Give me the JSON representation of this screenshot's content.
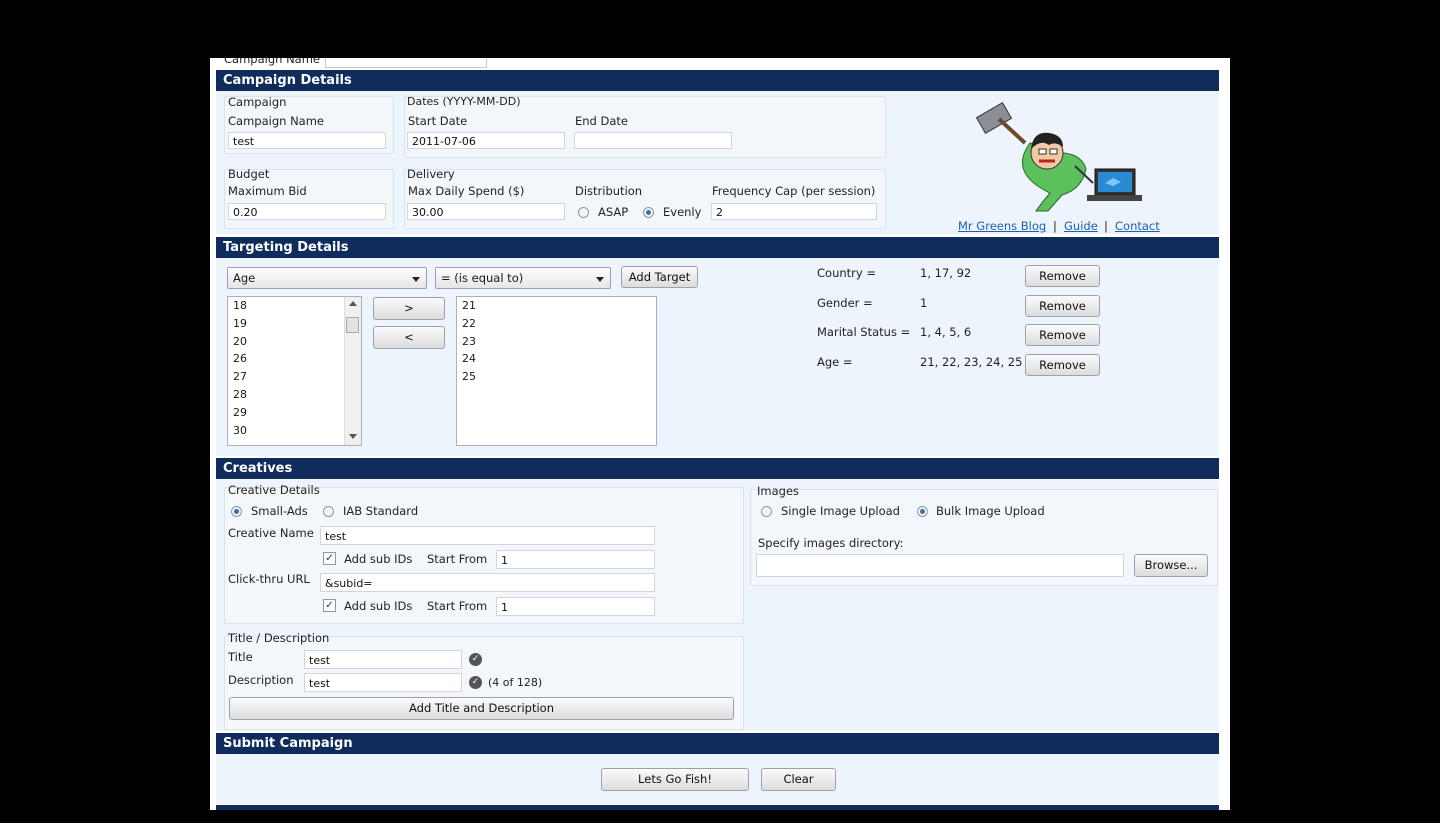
{
  "top": {
    "campaign_name_label": "Campaign Name"
  },
  "campaign_details": {
    "header": "Campaign Details",
    "campaign_group": "Campaign",
    "campaign_name_label": "Campaign Name",
    "campaign_name_value": "test",
    "dates_group": "Dates (YYYY-MM-DD)",
    "start_date_label": "Start Date",
    "start_date_value": "2011-07-06",
    "end_date_label": "End Date",
    "end_date_value": "",
    "budget_group": "Budget",
    "max_bid_label": "Maximum Bid",
    "max_bid_value": "0.20",
    "delivery_group": "Delivery",
    "max_daily_label": "Max Daily Spend ($)",
    "max_daily_value": "30.00",
    "distribution_label": "Distribution",
    "asap_label": "ASAP",
    "evenly_label": "Evenly",
    "distribution_selected": "Evenly",
    "freq_cap_label": "Frequency Cap (per  session)",
    "freq_cap_value": "2"
  },
  "links": {
    "blog": "Mr Greens Blog",
    "sep1": "|",
    "guide": "Guide",
    "sep2": "|",
    "contact": "Contact"
  },
  "targeting": {
    "header": "Targeting Details",
    "attribute_select": "Age",
    "operator_select": "= (is equal to)",
    "add_target_label": "Add Target",
    "move_right_label": ">",
    "move_left_label": "<",
    "available_values": [
      "18",
      "19",
      "20",
      "26",
      "27",
      "28",
      "29",
      "30"
    ],
    "selected_values": [
      "21",
      "22",
      "23",
      "24",
      "25"
    ],
    "rules": [
      {
        "name": "Country =",
        "values": "1, 17, 92",
        "remove": "Remove"
      },
      {
        "name": "Gender =",
        "values": "1",
        "remove": "Remove"
      },
      {
        "name": "Marital Status =",
        "values": "1, 4, 5, 6",
        "remove": "Remove"
      },
      {
        "name": "Age =",
        "values": "21, 22, 23, 24, 25",
        "remove": "Remove"
      }
    ]
  },
  "creatives": {
    "header": "Creatives",
    "details_group": "Creative Details",
    "small_ads_label": "Small-Ads",
    "iab_label": "IAB Standard",
    "format_selected": "Small-Ads",
    "creative_name_label": "Creative Name",
    "creative_name_value": "test",
    "add_sub_ids_label": "Add sub IDs",
    "start_from_label": "Start From",
    "start_from_value_1": "1",
    "click_url_label": "Click-thru URL",
    "click_url_value": "&subid=",
    "start_from_value_2": "1",
    "title_desc_group": "Title / Description",
    "title_label": "Title",
    "title_value": "test",
    "description_label": "Description",
    "description_value": "test",
    "desc_count": "(4 of 128)",
    "add_title_desc_label": "Add Title and Description",
    "images_group": "Images",
    "single_upload_label": "Single Image Upload",
    "bulk_upload_label": "Bulk Image Upload",
    "upload_selected": "Bulk Image Upload",
    "images_dir_label": "Specify images directory:",
    "images_dir_value": "",
    "browse_label": "Browse..."
  },
  "submit": {
    "header": "Submit Campaign",
    "go_label": "Lets Go Fish!",
    "clear_label": "Clear"
  },
  "colors": {
    "header_bar": "#0f2c5c",
    "panel_bg": "#eef4fb",
    "link": "#1b5fb5",
    "backdrop": "#000000"
  },
  "icons": {
    "mascot": "hammer-man-with-laptop-illustration",
    "check": "check-circle-icon",
    "dropdown": "chevron-down-icon"
  }
}
